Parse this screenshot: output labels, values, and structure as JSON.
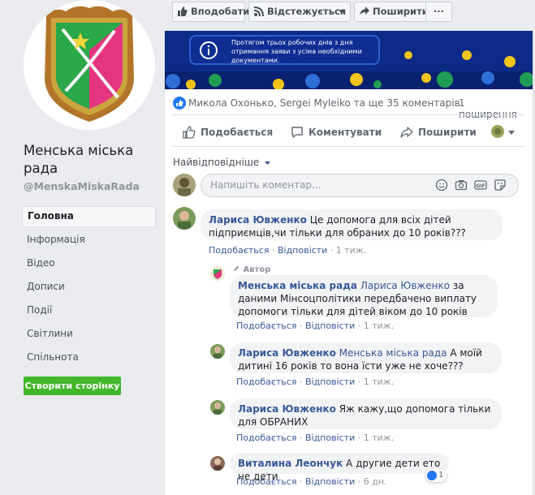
{
  "page": {
    "name": "Менська міська рада",
    "handle": "@MenskaMiskaRada",
    "nav": [
      "Головна",
      "Інформація",
      "Відео",
      "Дописи",
      "Події",
      "Світлини",
      "Спільнота"
    ],
    "create_page_label": "Створити сторінку"
  },
  "top_buttons": {
    "like_page": "Вподобати",
    "follow": "Відстежується",
    "share": "Поширити",
    "more": "···"
  },
  "banner": {
    "text": "Протягом трьох робочих днів з дня отримання заяви з усіма необхідними документами."
  },
  "post_stats": {
    "reactions_text": "Микола Охонько, Sergei Myleiko та ще 3",
    "comments_count": "5 коментарів",
    "shares_count": "1 поширення"
  },
  "post_actions": {
    "like": "Подобається",
    "comment": "Коментувати",
    "share": "Поширити"
  },
  "comments_sort": "Найвідповідніше",
  "composer": {
    "placeholder": "Напишіть коментар..."
  },
  "meta_labels": {
    "like": "Подобається",
    "reply": "Відповісти",
    "sep": "·"
  },
  "comments": [
    {
      "author": "Лариса Ювженко",
      "text": "Це допомога для всіх дітей підприємців,чи тільки для обраних до 10 років???",
      "time": "1 тиж."
    }
  ],
  "replies": [
    {
      "badge": "Автор",
      "author": "Менська міська рада",
      "tag": "Лариса Ювженко",
      "text": "за даними Мінсоцполітики передбачено виплату допомоги тільки для дітей віком до 10 років",
      "time": "1 тиж."
    },
    {
      "author": "Лариса Ювженко",
      "tag": "Менська міська рада",
      "text": "А моїй дитині 16 років то вона їсти уже не хоче???",
      "time": "1 тиж."
    },
    {
      "author": "Лариса Ювженко",
      "tag": "",
      "text": "Яж кажу,що допомога тільки для ОБРАНИХ",
      "time": "1 тиж."
    },
    {
      "author": "Виталина Леончук",
      "tag": "",
      "text": "А другие дети ето не дети",
      "time": "6 дн.",
      "likes": "1"
    }
  ],
  "colors": {
    "link": "#385898",
    "create_button": "#42b72a",
    "banner_bg": "#0d2a87"
  }
}
